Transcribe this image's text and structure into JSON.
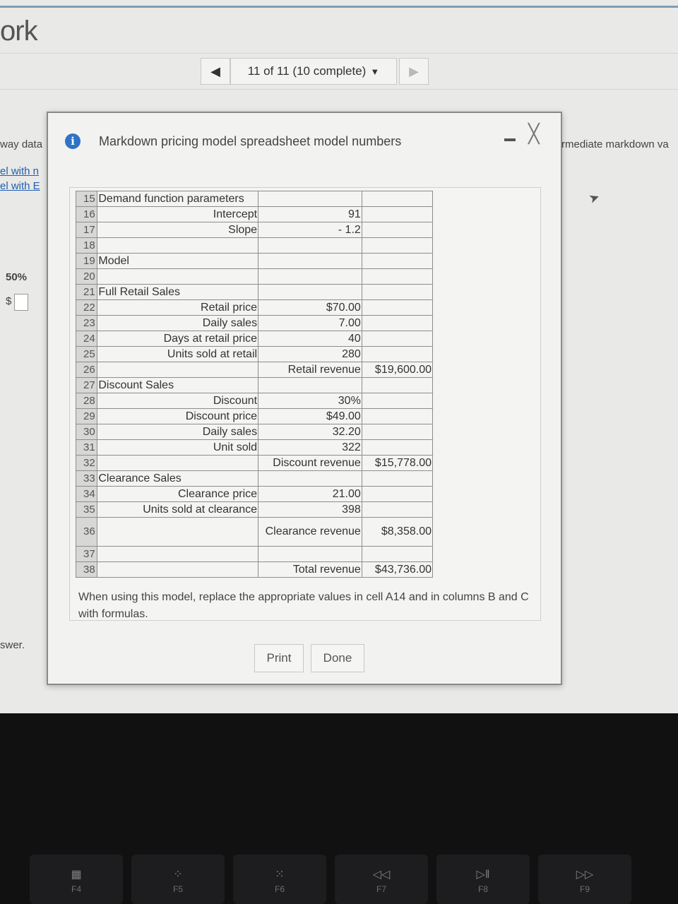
{
  "page": {
    "title": "ork",
    "nav": {
      "prev_icon": "◀",
      "counter": "11 of 11 (10 complete)",
      "dropdown_icon": "▼",
      "next_icon": "▶"
    },
    "left_labels": {
      "data": "way data",
      "link1": "el with n",
      "link2": "el with E",
      "percent": "50%",
      "dollar": "$",
      "answer": "swer."
    },
    "right_label": "rmediate markdown va"
  },
  "modal": {
    "title": "Markdown pricing model spreadsheet model numbers",
    "info_icon": "i",
    "close_icon": "╳",
    "rows": [
      {
        "n": "15",
        "a": "Demand function parameters",
        "a_align": "left",
        "b": "",
        "c": ""
      },
      {
        "n": "16",
        "a": "Intercept",
        "b": "91",
        "c": ""
      },
      {
        "n": "17",
        "a": "Slope",
        "b": "- 1.2",
        "c": ""
      },
      {
        "n": "18",
        "a": "",
        "b": "",
        "c": ""
      },
      {
        "n": "19",
        "a": "Model",
        "a_align": "left",
        "b": "",
        "c": ""
      },
      {
        "n": "20",
        "a": "",
        "b": "",
        "c": ""
      },
      {
        "n": "21",
        "a": "Full Retail Sales",
        "a_align": "left",
        "b": "",
        "c": ""
      },
      {
        "n": "22",
        "a": "Retail price",
        "b": "$70.00",
        "c": ""
      },
      {
        "n": "23",
        "a": "Daily sales",
        "b": "7.00",
        "c": ""
      },
      {
        "n": "24",
        "a": "Days at retail price",
        "b": "40",
        "c": ""
      },
      {
        "n": "25",
        "a": "Units sold at retail",
        "b": "280",
        "c": ""
      },
      {
        "n": "26",
        "a": "",
        "b": "Retail revenue",
        "c": "$19,600.00"
      },
      {
        "n": "27",
        "a": "Discount Sales",
        "a_align": "left",
        "b": "",
        "c": ""
      },
      {
        "n": "28",
        "a": "Discount",
        "b": "30%",
        "c": ""
      },
      {
        "n": "29",
        "a": "Discount price",
        "b": "$49.00",
        "c": ""
      },
      {
        "n": "30",
        "a": "Daily sales",
        "b": "32.20",
        "c": ""
      },
      {
        "n": "31",
        "a": "Unit sold",
        "b": "322",
        "c": ""
      },
      {
        "n": "32",
        "a": "",
        "b": "Discount revenue",
        "c": "$15,778.00"
      },
      {
        "n": "33",
        "a": "Clearance Sales",
        "a_align": "left",
        "b": "",
        "c": ""
      },
      {
        "n": "34",
        "a": "Clearance price",
        "b": "21.00",
        "c": ""
      },
      {
        "n": "35",
        "a": "Units sold at clearance",
        "b": "398",
        "c": ""
      },
      {
        "n": "36",
        "a": "",
        "b": "Clearance revenue",
        "c": "$8,358.00",
        "tall": true
      },
      {
        "n": "37",
        "a": "",
        "b": "",
        "c": ""
      },
      {
        "n": "38",
        "a": "",
        "b": "Total revenue",
        "c": "$43,736.00"
      }
    ],
    "note": "When using this model, replace the appropriate values in cell A14 and in columns B and C with formulas.",
    "print_label": "Print",
    "done_label": "Done"
  },
  "keyboard": [
    {
      "label": "F4",
      "icon": "launchpad-icon",
      "glyph": "▦"
    },
    {
      "label": "F5",
      "icon": "keyboard-brightness-down-icon",
      "glyph": "⁘"
    },
    {
      "label": "F6",
      "icon": "keyboard-brightness-up-icon",
      "glyph": "⁙"
    },
    {
      "label": "F7",
      "icon": "rewind-icon",
      "glyph": "◁◁"
    },
    {
      "label": "F8",
      "icon": "play-pause-icon",
      "glyph": "▷‖"
    },
    {
      "label": "F9",
      "icon": "fast-forward-icon",
      "glyph": "▷▷"
    }
  ]
}
